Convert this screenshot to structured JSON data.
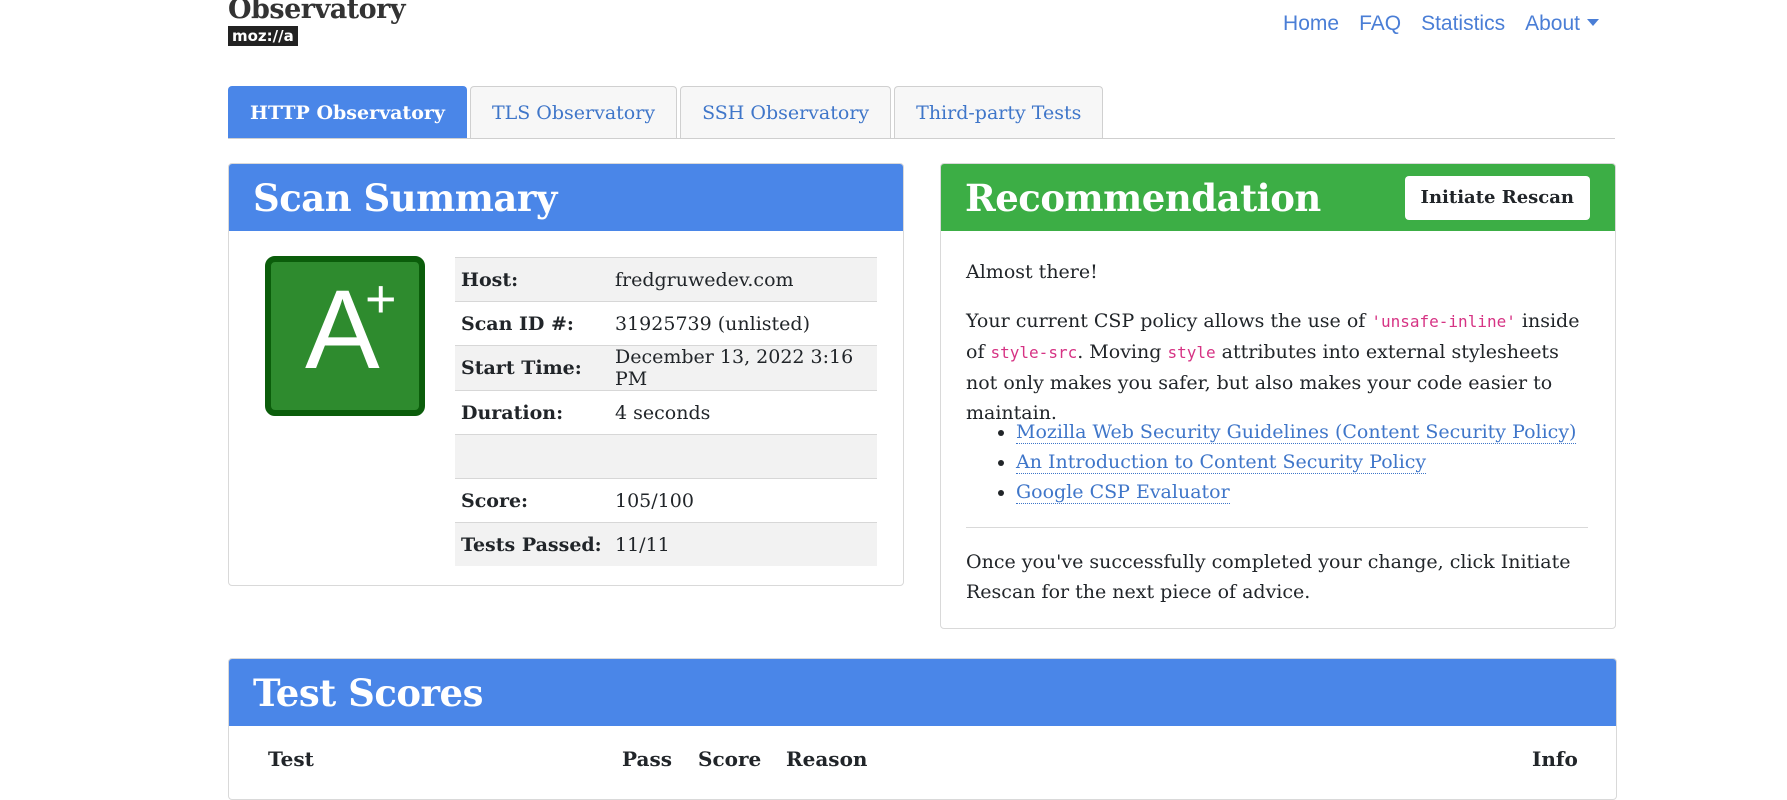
{
  "brand": {
    "title": "Observatory",
    "sub": "moz://a"
  },
  "nav": {
    "home": "Home",
    "faq": "FAQ",
    "statistics": "Statistics",
    "about": "About"
  },
  "tabs": [
    "HTTP Observatory",
    "TLS Observatory",
    "SSH Observatory",
    "Third-party Tests"
  ],
  "summary": {
    "title": "Scan Summary",
    "grade": "A",
    "grade_modifier": "+",
    "rows": [
      {
        "label": "Host:",
        "value": "fredgruwedev.com"
      },
      {
        "label": "Scan ID #:",
        "value": "31925739 (unlisted)"
      },
      {
        "label": "Start Time:",
        "value": "December 13, 2022 3:16 PM"
      },
      {
        "label": "Duration:",
        "value": "4 seconds"
      },
      {
        "label": "",
        "value": ""
      },
      {
        "label": "Score:",
        "value": "105/100"
      },
      {
        "label": "Tests Passed:",
        "value": "11/11"
      }
    ]
  },
  "recommendation": {
    "title": "Recommendation",
    "rescan_label": "Initiate Rescan",
    "intro": "Almost there!",
    "p2_a": "Your current CSP policy allows the use of ",
    "p2_code1": "'unsafe-inline'",
    "p2_b": " inside of ",
    "p2_code2": "style-src",
    "p2_c": ". Moving ",
    "p2_code3": "style",
    "p2_d": " attributes into external stylesheets not only makes you safer, but also makes your code easier to maintain.",
    "links": [
      "Mozilla Web Security Guidelines (Content Security Policy)",
      "An Introduction to Content Security Policy",
      "Google CSP Evaluator"
    ],
    "outro": "Once you've successfully completed your change, click Initiate Rescan for the next piece of advice."
  },
  "scores": {
    "title": "Test Scores",
    "columns": {
      "test": "Test",
      "pass": "Pass",
      "score": "Score",
      "reason": "Reason",
      "info": "Info"
    }
  }
}
